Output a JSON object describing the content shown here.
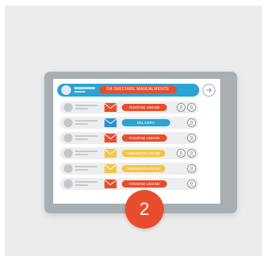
{
  "banner": {
    "text": "DA SMISTARE MANUALMENTE"
  },
  "rows": [
    {
      "tag": "RISORSE UMANE",
      "tag_color": "#e84c2c",
      "mail_color": "#e84c2c",
      "users": 2
    },
    {
      "tag": "DELIVERY",
      "tag_color": "#2aa3d5",
      "mail_color": "#2a8fd0",
      "users": 1
    },
    {
      "tag": "RISORSE UMANE",
      "tag_color": "#e84c2c",
      "mail_color": "#e84c2c",
      "users": 1
    },
    {
      "tag": "AMMINISTRAZIONE",
      "tag_color": "#f5c542",
      "mail_color": "#f5c542",
      "users": 2
    },
    {
      "tag": "AMMINISTRAZIONE",
      "tag_color": "#f5c542",
      "mail_color": "#f5c542",
      "users": 1
    },
    {
      "tag": "RISORSE UMANE",
      "tag_color": "#e84c2c",
      "mail_color": "#e84c2c",
      "users": 1
    }
  ],
  "step_badge": {
    "number": "2"
  },
  "colors": {
    "accent_blue": "#2aa3d5",
    "accent_red": "#e84c2c",
    "accent_yellow": "#f5c542",
    "tablet_frame": "#a9aeb3",
    "background": "#ececec"
  },
  "icons": {
    "next": "arrow-right-circle-icon",
    "mail": "envelope-icon",
    "user": "user-icon",
    "avatar": "avatar"
  }
}
